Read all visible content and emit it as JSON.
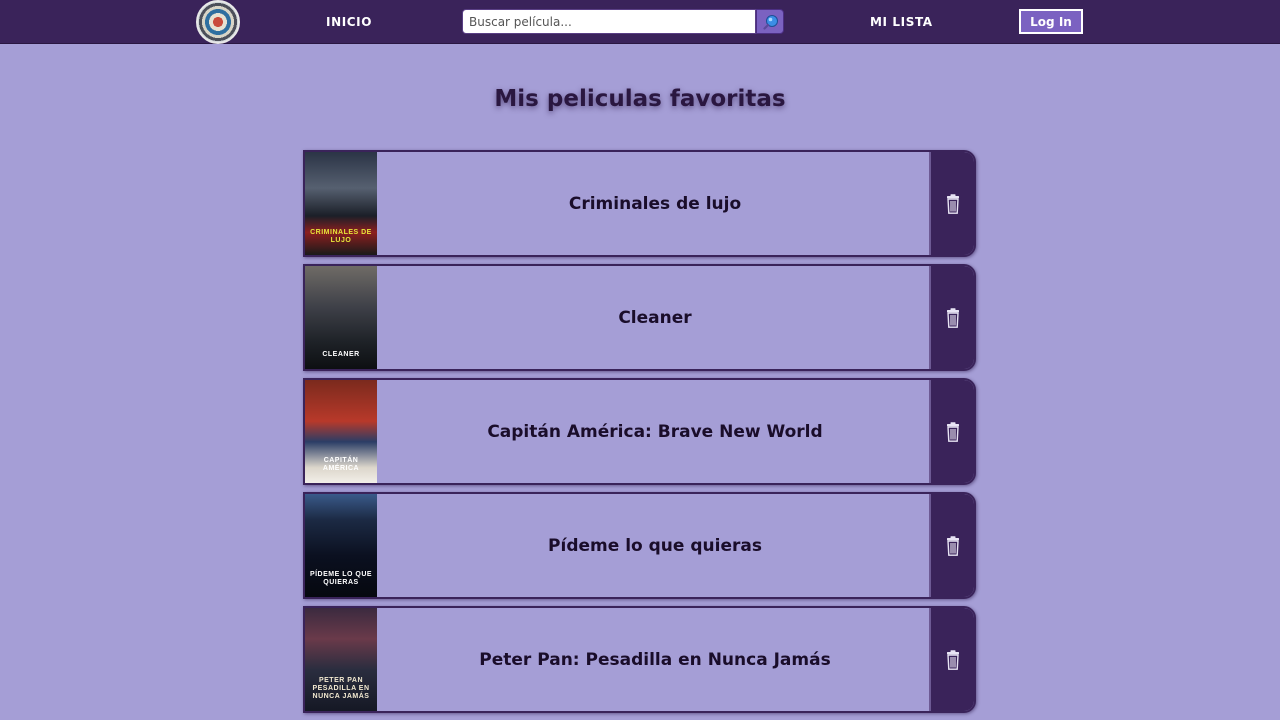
{
  "nav": {
    "logo_icon": "circular-logo-icon",
    "inicio_label": "INICIO",
    "search_placeholder": "Buscar película...",
    "search_value": "",
    "search_icon": "magnifier-icon",
    "milista_label": "MI LISTA",
    "login_label": "Log In"
  },
  "page": {
    "title": "Mis peliculas favoritas"
  },
  "movies": [
    {
      "title": "Criminales de lujo",
      "poster_text": "CRIMINALES DE LUJO",
      "delete_icon": "trash-icon"
    },
    {
      "title": "Cleaner",
      "poster_text": "CLEANER",
      "delete_icon": "trash-icon"
    },
    {
      "title": "Capitán América: Brave New World",
      "poster_text": "CAPITÁN AMÉRICA",
      "delete_icon": "trash-icon"
    },
    {
      "title": "Pídeme lo que quieras",
      "poster_text": "PÍDEME LO QUE QUIERAS",
      "delete_icon": "trash-icon"
    },
    {
      "title": "Peter Pan: Pesadilla en Nunca Jamás",
      "poster_text": "PETER PAN PESADILLA EN NUNCA JAMÁS",
      "delete_icon": "trash-icon"
    }
  ],
  "colors": {
    "background": "#a59ed6",
    "navbar": "#3a235a",
    "accent": "#7b62c1",
    "title_text": "#1a0d2a"
  }
}
